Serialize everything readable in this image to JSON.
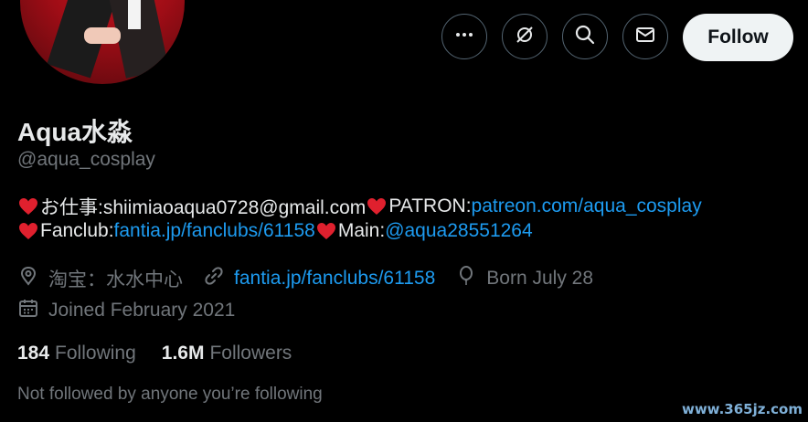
{
  "profile": {
    "name": "Aqua水淼",
    "handle": "@aqua_cosplay"
  },
  "actions": {
    "more_icon": "more-icon",
    "subscribe_icon": "subscribe-icon",
    "search_icon": "search-icon",
    "message_icon": "message-icon",
    "follow_label": "Follow"
  },
  "bio": {
    "line1_text1": "お仕事:shiimiaoaqua0728@gmail.com",
    "line1_text2": "PATRON: ",
    "line1_link": "patreon.com/aqua_cosplay",
    "line2_text1": "Fanclub: ",
    "line2_link": "fantia.jp/fanclubs/61158",
    "line2_text2": "Main:",
    "line2_mention": "@aqua28551264"
  },
  "meta": {
    "location": "淘宝：水水中心",
    "website": "fantia.jp/fanclubs/61158",
    "birthday": "Born July 28",
    "joined": "Joined February 2021"
  },
  "stats": {
    "following_count": "184",
    "following_label": "Following",
    "followers_count": "1.6M",
    "followers_label": "Followers"
  },
  "followed_by_note": "Not followed by anyone you’re following",
  "watermark": "www.365jz.com",
  "colors": {
    "background": "#000000",
    "text_primary": "#e7e9ea",
    "text_secondary": "#71767b",
    "link": "#1d9bf0",
    "heart": "#e0202e",
    "follow_button_bg": "#eff3f4"
  }
}
